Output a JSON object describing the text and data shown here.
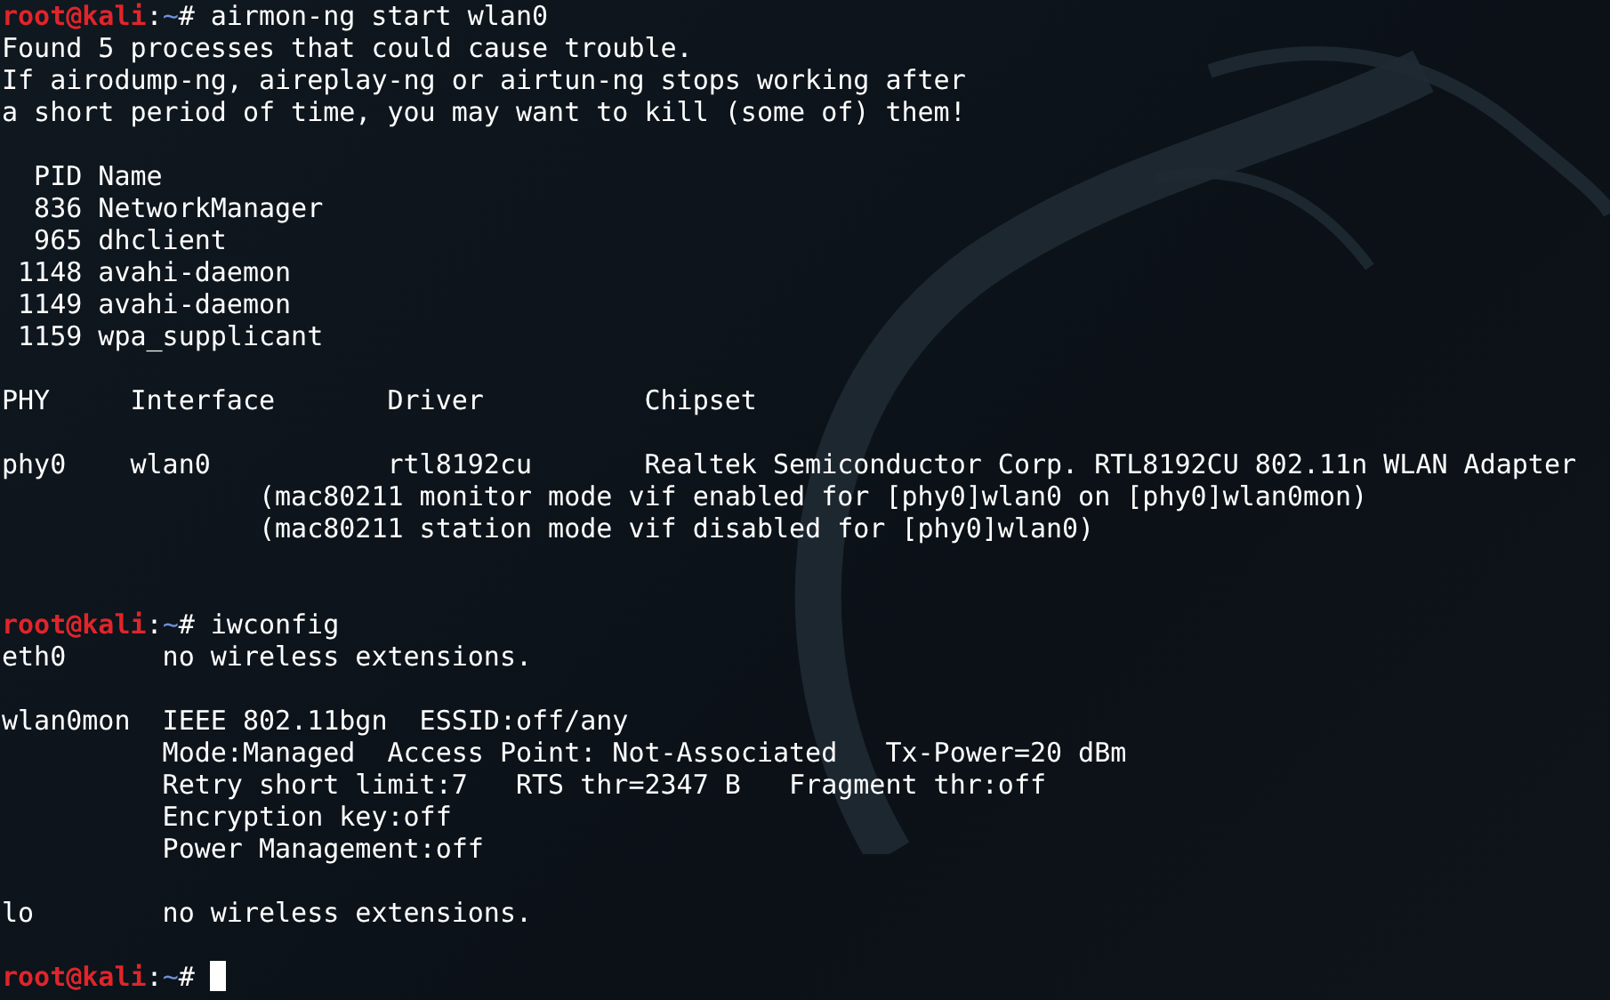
{
  "terminal": {
    "lines": [
      {
        "kind": "prompt",
        "user": "root@kali",
        "separator": ":",
        "dir": "~",
        "symbol": "#",
        "command": "airmon-ng start wlan0",
        "cursor": false
      },
      {
        "kind": "output",
        "text": "Found 5 processes that could cause trouble."
      },
      {
        "kind": "output",
        "text": "If airodump-ng, aireplay-ng or airtun-ng stops working after"
      },
      {
        "kind": "output",
        "text": "a short period of time, you may want to kill (some of) them!"
      },
      {
        "kind": "blank"
      },
      {
        "kind": "output",
        "text": "  PID Name"
      },
      {
        "kind": "output",
        "text": "  836 NetworkManager"
      },
      {
        "kind": "output",
        "text": "  965 dhclient"
      },
      {
        "kind": "output",
        "text": " 1148 avahi-daemon"
      },
      {
        "kind": "output",
        "text": " 1149 avahi-daemon"
      },
      {
        "kind": "output",
        "text": " 1159 wpa_supplicant"
      },
      {
        "kind": "blank"
      },
      {
        "kind": "output",
        "text": "PHY     Interface       Driver          Chipset"
      },
      {
        "kind": "blank"
      },
      {
        "kind": "output",
        "text": "phy0    wlan0           rtl8192cu       Realtek Semiconductor Corp. RTL8192CU 802.11n WLAN Adapter"
      },
      {
        "kind": "output",
        "text": "                (mac80211 monitor mode vif enabled for [phy0]wlan0 on [phy0]wlan0mon)"
      },
      {
        "kind": "output",
        "text": "                (mac80211 station mode vif disabled for [phy0]wlan0)"
      },
      {
        "kind": "blank"
      },
      {
        "kind": "blank"
      },
      {
        "kind": "prompt",
        "user": "root@kali",
        "separator": ":",
        "dir": "~",
        "symbol": "#",
        "command": "iwconfig",
        "cursor": false
      },
      {
        "kind": "output",
        "text": "eth0      no wireless extensions."
      },
      {
        "kind": "blank"
      },
      {
        "kind": "output",
        "text": "wlan0mon  IEEE 802.11bgn  ESSID:off/any"
      },
      {
        "kind": "output",
        "text": "          Mode:Managed  Access Point: Not-Associated   Tx-Power=20 dBm"
      },
      {
        "kind": "output",
        "text": "          Retry short limit:7   RTS thr=2347 B   Fragment thr:off"
      },
      {
        "kind": "output",
        "text": "          Encryption key:off"
      },
      {
        "kind": "output",
        "text": "          Power Management:off"
      },
      {
        "kind": "blank"
      },
      {
        "kind": "output",
        "text": "lo        no wireless extensions."
      },
      {
        "kind": "blank"
      },
      {
        "kind": "prompt",
        "user": "root@kali",
        "separator": ":",
        "dir": "~",
        "symbol": "#",
        "cursor": true
      }
    ]
  }
}
